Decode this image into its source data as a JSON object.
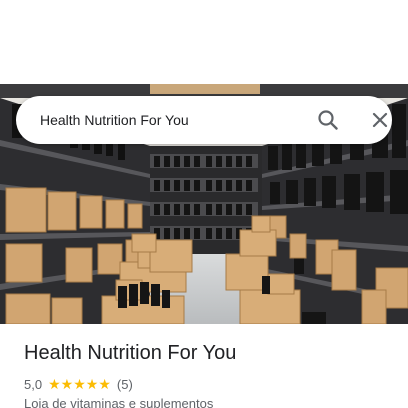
{
  "search": {
    "query": "Health Nutrition For You",
    "search_icon": "search-icon",
    "close_icon": "close-icon"
  },
  "photo": {
    "subject": "warehouse-shelves-photo"
  },
  "place": {
    "name": "Health Nutrition For You",
    "rating": "5,0",
    "stars": 5,
    "review_count": "(5)",
    "category": "Loja de vitaminas e suplementos"
  },
  "colors": {
    "star": "#fbbc04",
    "title_text": "#202124",
    "secondary_text": "#5f6368"
  }
}
